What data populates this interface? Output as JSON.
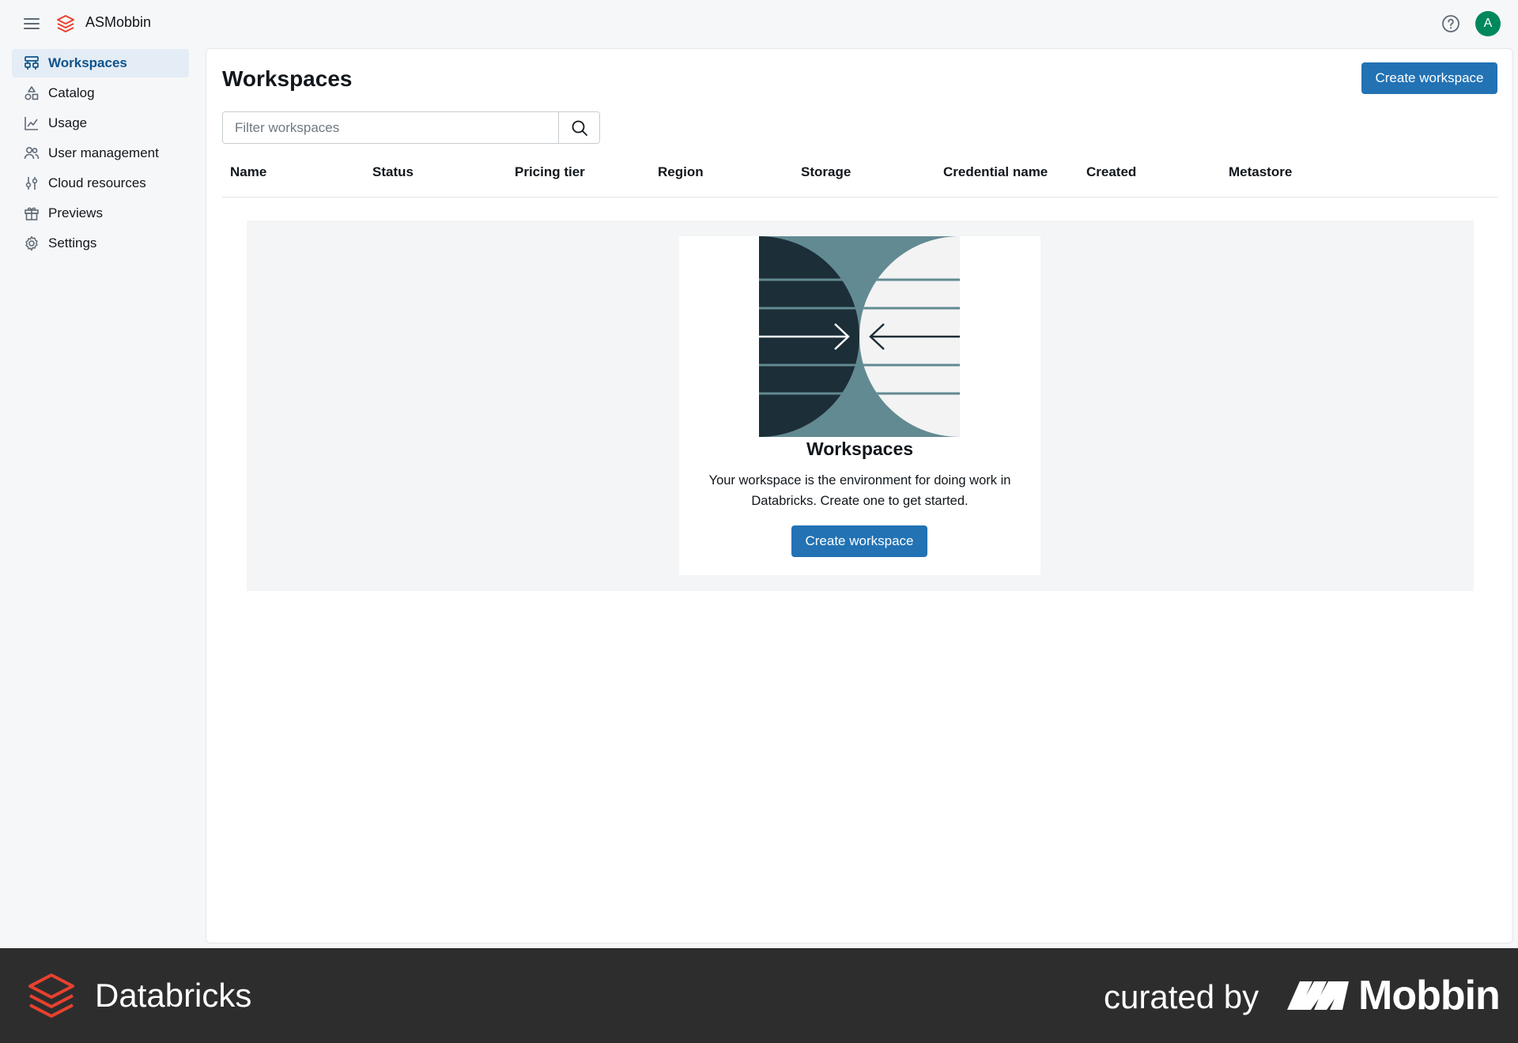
{
  "topbar": {
    "brand_name": "ASMobbin",
    "avatar_initial": "A"
  },
  "sidebar": {
    "items": [
      {
        "label": "Workspaces",
        "icon": "workspaces-icon",
        "active": true
      },
      {
        "label": "Catalog",
        "icon": "catalog-icon"
      },
      {
        "label": "Usage",
        "icon": "usage-chart-icon"
      },
      {
        "label": "User management",
        "icon": "users-icon"
      },
      {
        "label": "Cloud resources",
        "icon": "sliders-icon"
      },
      {
        "label": "Previews",
        "icon": "gift-icon"
      },
      {
        "label": "Settings",
        "icon": "gear-icon"
      }
    ]
  },
  "main": {
    "title": "Workspaces",
    "create_button": "Create workspace",
    "filter_placeholder": "Filter workspaces",
    "columns": [
      "Name",
      "Status",
      "Pricing tier",
      "Region",
      "Storage",
      "Credential name",
      "Created",
      "Metastore"
    ]
  },
  "empty_state": {
    "title": "Workspaces",
    "description": "Your workspace is the environment for doing work in Databricks. Create one to get started.",
    "button": "Create workspace"
  },
  "footer": {
    "brand": "Databricks",
    "curated_by": "curated by",
    "curator": "Mobbin"
  },
  "colors": {
    "primary": "#2272b4",
    "active_nav_bg": "#e4ecf5",
    "active_nav_text": "#0e538b",
    "avatar": "#00875c",
    "footer_bg": "#2d2d2e",
    "brand_red": "#e8412e"
  }
}
